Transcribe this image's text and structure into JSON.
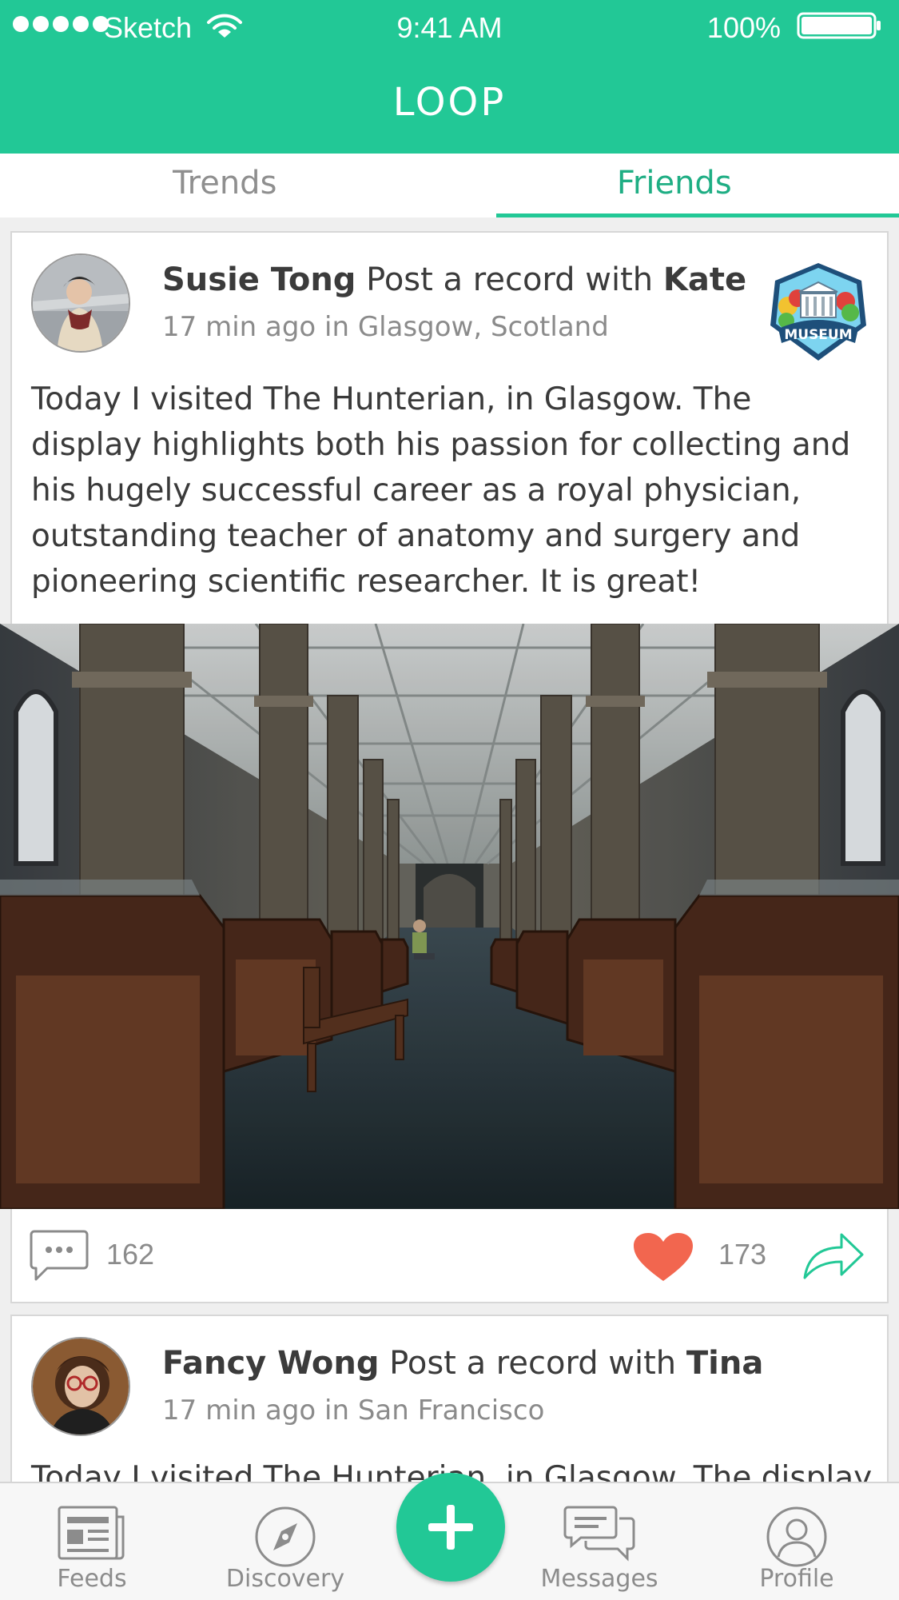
{
  "status_bar": {
    "carrier": "Sketch",
    "time": "9:41 AM",
    "battery": "100%"
  },
  "header": {
    "title": "LOOP"
  },
  "tabs": [
    {
      "label": "Trends",
      "active": false
    },
    {
      "label": "Friends",
      "active": true
    }
  ],
  "posts": [
    {
      "author": "Susie Tong",
      "action": "Post a record with",
      "with": "Kate",
      "time_place": "17 min ago in Glasgow, Scotland",
      "badge": "MUSEUM",
      "text": "Today I visited The Hunterian, in Glasgow. The display highlights both his passion for collecting and his hugely successful career as a royal physician, outstanding teacher of anatomy and surgery and pioneering scientific researcher. It is great!",
      "comments": "162",
      "likes": "173"
    },
    {
      "author": "Fancy Wong",
      "action": "Post a record with",
      "with": "Tina",
      "time_place": "17 min ago in San Francisco",
      "text": "Today I visited The Hunterian, in Glasgow. The display"
    }
  ],
  "tabbar": {
    "items": [
      {
        "label": "Feeds",
        "icon": "newspaper-icon"
      },
      {
        "label": "Discovery",
        "icon": "compass-icon"
      },
      {
        "label": "Messages",
        "icon": "chat-bubbles-icon"
      },
      {
        "label": "Profile",
        "icon": "user-icon"
      }
    ],
    "fab_icon": "plus-icon"
  },
  "colors": {
    "accent": "#22c896",
    "accent_dark": "#1fae84",
    "heart": "#f2664f"
  }
}
